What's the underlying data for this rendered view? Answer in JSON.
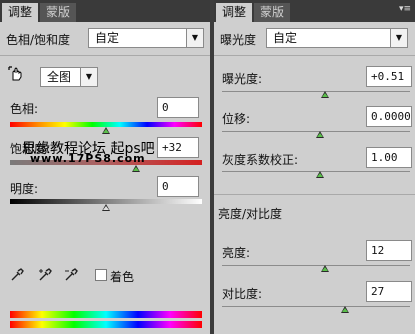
{
  "left_panel": {
    "tabs": [
      {
        "label": "调整"
      },
      {
        "label": "蒙版"
      }
    ],
    "title": "色相/饱和度",
    "preset": "自定",
    "channel": "全图",
    "hue": {
      "label": "色相:",
      "value": "0",
      "level": 0.5
    },
    "saturation": {
      "label": "饱和度:",
      "value": "+32",
      "level": 0.66
    },
    "lightness": {
      "label": "明度:",
      "value": "0",
      "level": 0.5
    },
    "colorize_label": "着色",
    "watermark": {
      "line1": "思缘教程论坛 起ps吧",
      "line2": "www.17PS8.com"
    }
  },
  "right_panel": {
    "tabs": [
      {
        "label": "调整"
      },
      {
        "label": "蒙版"
      }
    ],
    "title": "曝光度",
    "preset": "自定",
    "exposure": {
      "label": "曝光度:",
      "value": "+0.51",
      "level": 0.55
    },
    "offset": {
      "label": "位移:",
      "value": "0.0000",
      "level": 0.5
    },
    "gamma": {
      "label": "灰度系数校正:",
      "value": "1.00",
      "level": 0.5
    },
    "section_title": "亮度/对比度",
    "brightness": {
      "label": "亮度:",
      "value": "12",
      "level": 0.53
    },
    "contrast": {
      "label": "对比度:",
      "value": "27",
      "level": 0.64
    }
  },
  "colors": {
    "panel_bg": "#cfcfcf",
    "tab_bar": "#3a3a3a",
    "handle_fill": "#5bbf4b"
  }
}
